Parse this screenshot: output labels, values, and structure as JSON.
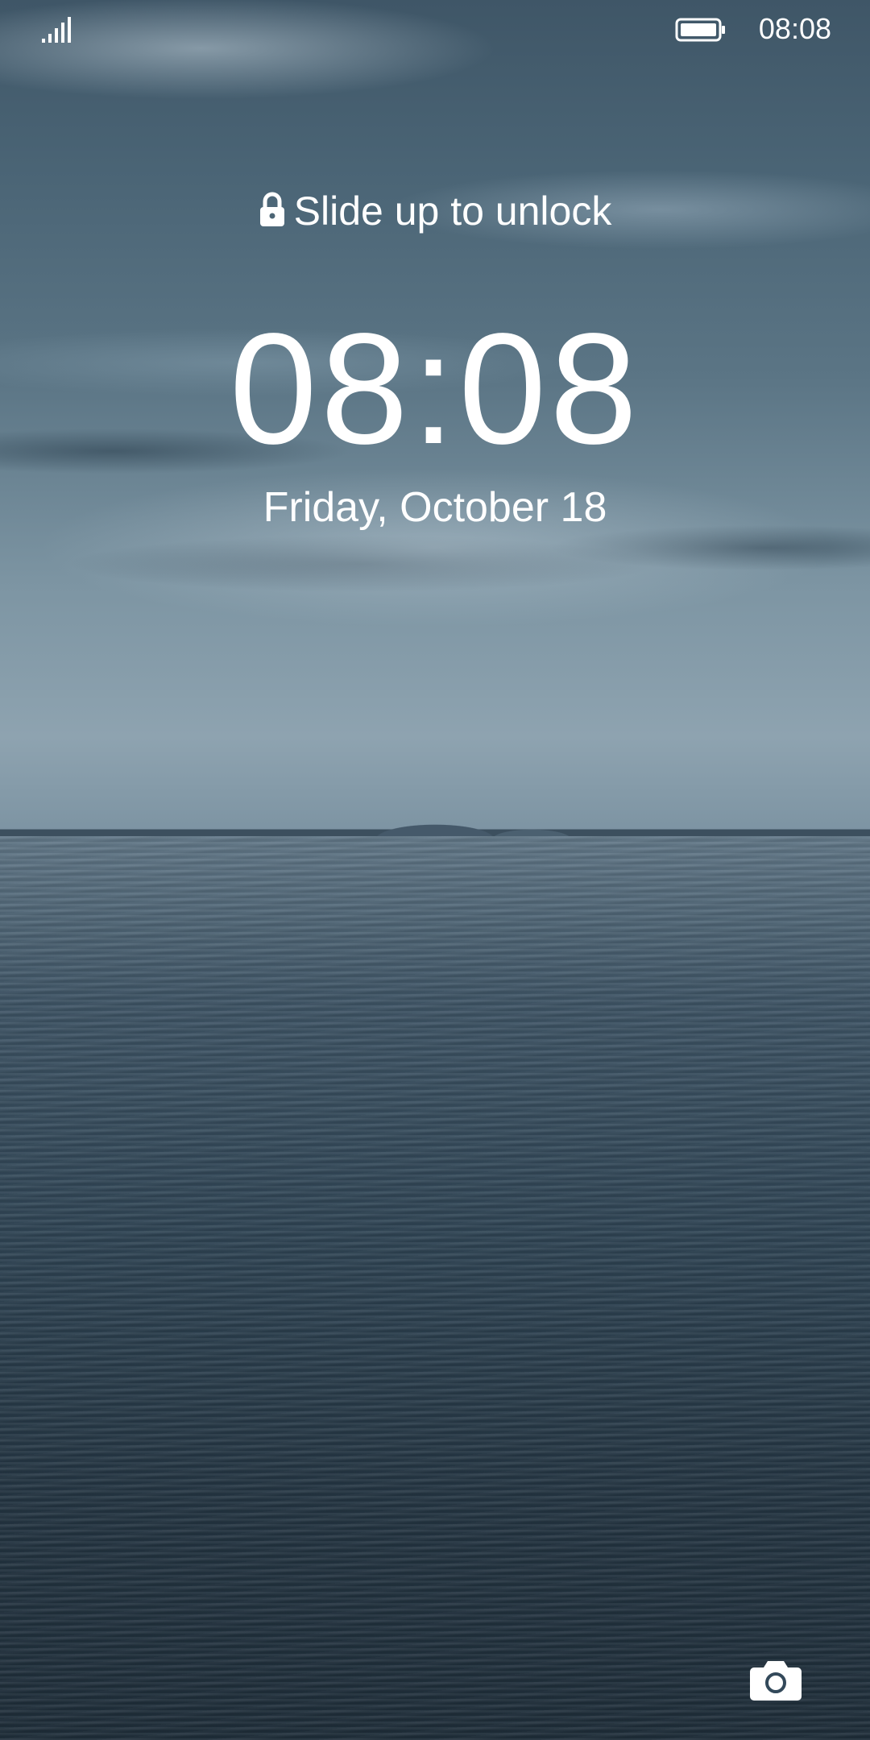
{
  "status_bar": {
    "time": "08:08",
    "signal_icon": "signal-icon",
    "battery_icon": "battery-icon"
  },
  "lock_screen": {
    "unlock_hint": "Slide up to unlock",
    "lock_icon": "lock-icon",
    "clock": "08:08",
    "date": "Friday, October 18",
    "camera_icon": "camera-icon"
  },
  "colors": {
    "text": "#ffffff",
    "sky": "#5b7585",
    "sea": "#2f4454"
  }
}
